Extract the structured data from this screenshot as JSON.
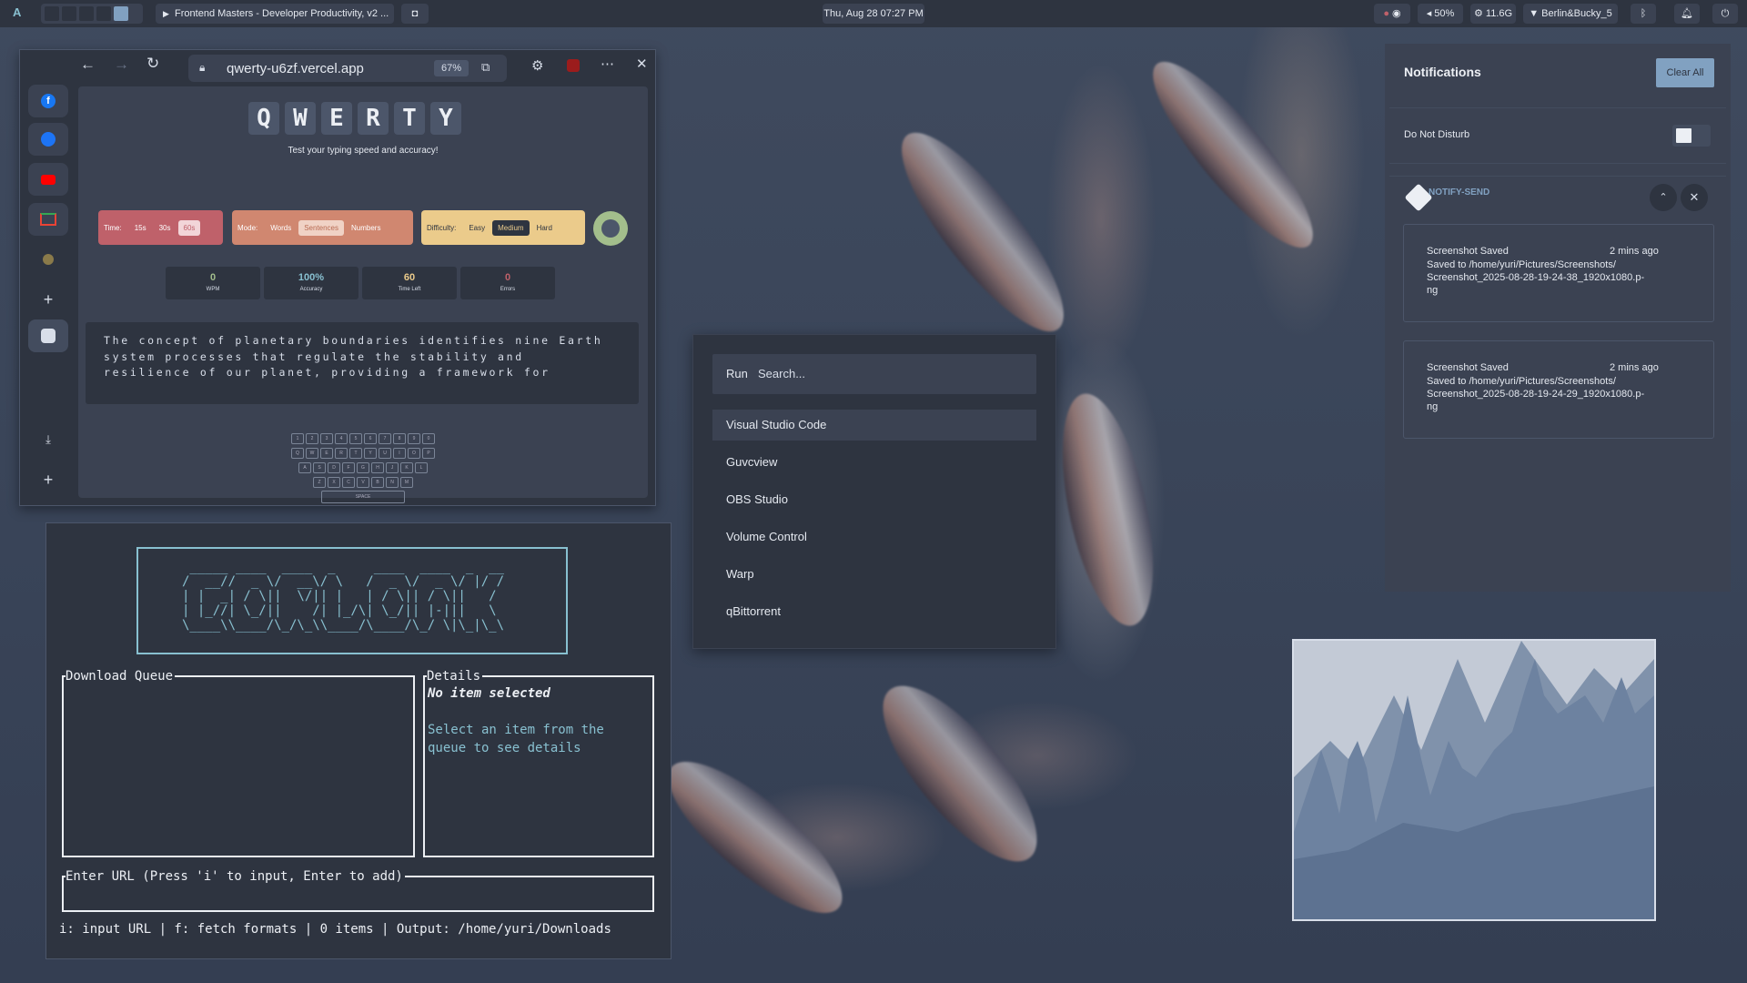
{
  "topbar": {
    "logo": "A",
    "active_window": "Frontend Masters - Developer Productivity, v2 ...",
    "datetime": "Thu, Aug 28  07:27 PM",
    "volume": "50%",
    "memory": "11.6G",
    "wifi": "Berlin&Bucky_5"
  },
  "browser": {
    "url": "qwerty-u6zf.vercel.app",
    "zoom": "67%"
  },
  "qwerty": {
    "letters": [
      "Q",
      "W",
      "E",
      "R",
      "T",
      "Y"
    ],
    "subtitle": "Test your typing speed and accuracy!",
    "time_label": "Time:",
    "time_options": [
      "15s",
      "30s",
      "60s"
    ],
    "mode_label": "Mode:",
    "mode_options": [
      "Words",
      "Sentences",
      "Numbers"
    ],
    "difficulty_label": "Difficulty:",
    "difficulty_options": [
      "Easy",
      "Medium",
      "Hard"
    ],
    "stats": [
      {
        "value": "0",
        "label": "WPM",
        "color": "#a3be8c"
      },
      {
        "value": "100%",
        "label": "Accuracy",
        "color": "#88c0d0"
      },
      {
        "value": "60",
        "label": "Time Left",
        "color": "#ebcb8b"
      },
      {
        "value": "0",
        "label": "Errors",
        "color": "#bf616a"
      }
    ],
    "text_lines": [
      "The concept of planetary boundaries identifies nine Earth",
      "system processes that regulate the stability and",
      "resilience of our planet, providing a framework for"
    ],
    "keyboard_rows": [
      [
        "1",
        "2",
        "3",
        "4",
        "5",
        "6",
        "7",
        "8",
        "9",
        "0"
      ],
      [
        "Q",
        "W",
        "E",
        "R",
        "T",
        "Y",
        "U",
        "I",
        "O",
        "P"
      ],
      [
        "A",
        "S",
        "D",
        "F",
        "G",
        "H",
        "J",
        "K",
        "L"
      ],
      [
        "Z",
        "X",
        "C",
        "V",
        "B",
        "N",
        "M"
      ]
    ],
    "space_label": "SPACE"
  },
  "terminal": {
    "ascii_art": [
      " _____ ____  ____  _     ____  ____  _  __ ",
      "/  __//  _ \\/  __\\/ \\   /  _ \\/  _ \\/ |/ / ",
      "| |  _| / \\||  \\/|| |   | / \\|| / \\||   /  ",
      "| |_//| \\_/||    /| |_/\\| \\_/|| |-|||   \\  ",
      "\\____\\\\____/\\_/\\_\\\\____/\\____/\\_/ \\|\\_|\\_\\ "
    ],
    "queue_title": "Download Queue",
    "details_title": "Details",
    "details_empty": "No item selected",
    "details_hint_1": "Select an item from the",
    "details_hint_2": "queue to see details",
    "input_title": "Enter URL (Press 'i' to input, Enter to add)",
    "status": "i: input URL | f: fetch formats | 0 items | Output: /home/yuri/Downloads"
  },
  "launcher": {
    "prompt": "Run",
    "placeholder": "Search...",
    "items": [
      "Visual Studio Code",
      "Guvcview",
      "OBS Studio",
      "Volume Control",
      "Warp",
      "qBittorrent"
    ]
  },
  "notifications": {
    "title": "Notifications",
    "clear_all": "Clear All",
    "dnd_label": "Do Not Disturb",
    "group_name": "NOTIFY-SEND",
    "items": [
      {
        "title": "Screenshot Saved",
        "time": "2 mins ago",
        "line1": "Saved to /home/yuri/Pictures/Screenshots/",
        "line2": "Screenshot_2025-08-28-19-24-38_1920x1080.p-",
        "line3": "ng"
      },
      {
        "title": "Screenshot Saved",
        "time": "2 mins ago",
        "line1": "Saved to /home/yuri/Pictures/Screenshots/",
        "line2": "Screenshot_2025-08-28-19-24-29_1920x1080.p-",
        "line3": "ng"
      }
    ]
  },
  "colors": {
    "time_pill": "#bf616a",
    "mode_pill": "#d08770",
    "difficulty_pill": "#ebcb8b",
    "accent": "#88c0d0",
    "nord_bg": "#2e3440"
  }
}
